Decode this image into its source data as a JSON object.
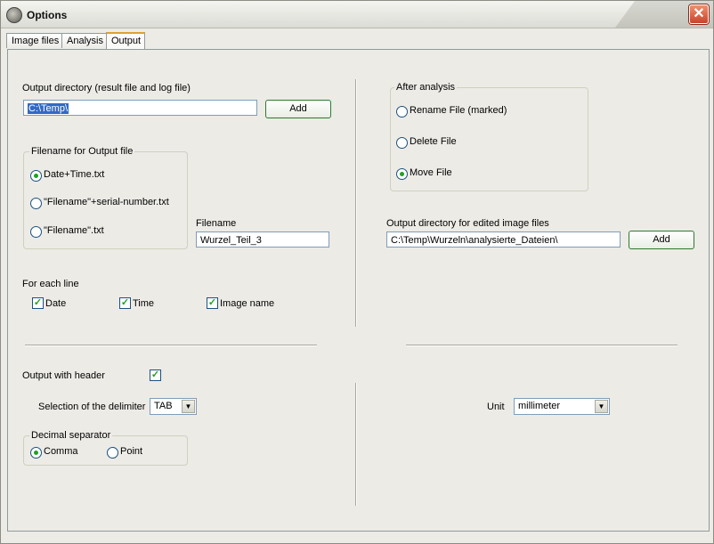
{
  "window": {
    "title": "Options",
    "close_symbol": "✕"
  },
  "tabs": [
    "Image files",
    "Analysis",
    "Output"
  ],
  "left": {
    "output_dir_label": "Output directory (result file and log file)",
    "output_dir_value": "C:\\Temp\\",
    "add_label": "Add",
    "filename_group": {
      "legend": "Filename for Output file",
      "options": [
        "Date+Time.txt",
        "\"Filename\"+serial-number.txt",
        "\"Filename\".txt"
      ],
      "selected": 0
    },
    "filename_label": "Filename",
    "filename_value": "Wurzel_Teil_3",
    "for_each_line_label": "For each line",
    "checks": [
      {
        "label": "Date",
        "checked": true
      },
      {
        "label": "Time",
        "checked": true
      },
      {
        "label": "Image name",
        "checked": true
      }
    ],
    "output_header_label": "Output with header",
    "output_header_checked": true,
    "delimiter_label": "Selection of the delimiter",
    "delimiter_value": "TAB",
    "decimal_group": {
      "legend": "Decimal separator",
      "options": [
        "Comma",
        "Point"
      ],
      "selected": 0
    }
  },
  "right": {
    "after_group": {
      "legend": "After analysis",
      "options": [
        "Rename File (marked)",
        "Delete File",
        "Move File"
      ],
      "selected": 2
    },
    "edited_dir_label": "Output directory for edited image files",
    "edited_dir_value": "C:\\Temp\\Wurzeln\\analysierte_Dateien\\",
    "add_label": "Add",
    "unit_label": "Unit",
    "unit_value": "millimeter"
  },
  "icons": {
    "dropdown_arrow": "▼",
    "check_mark": "✓"
  }
}
